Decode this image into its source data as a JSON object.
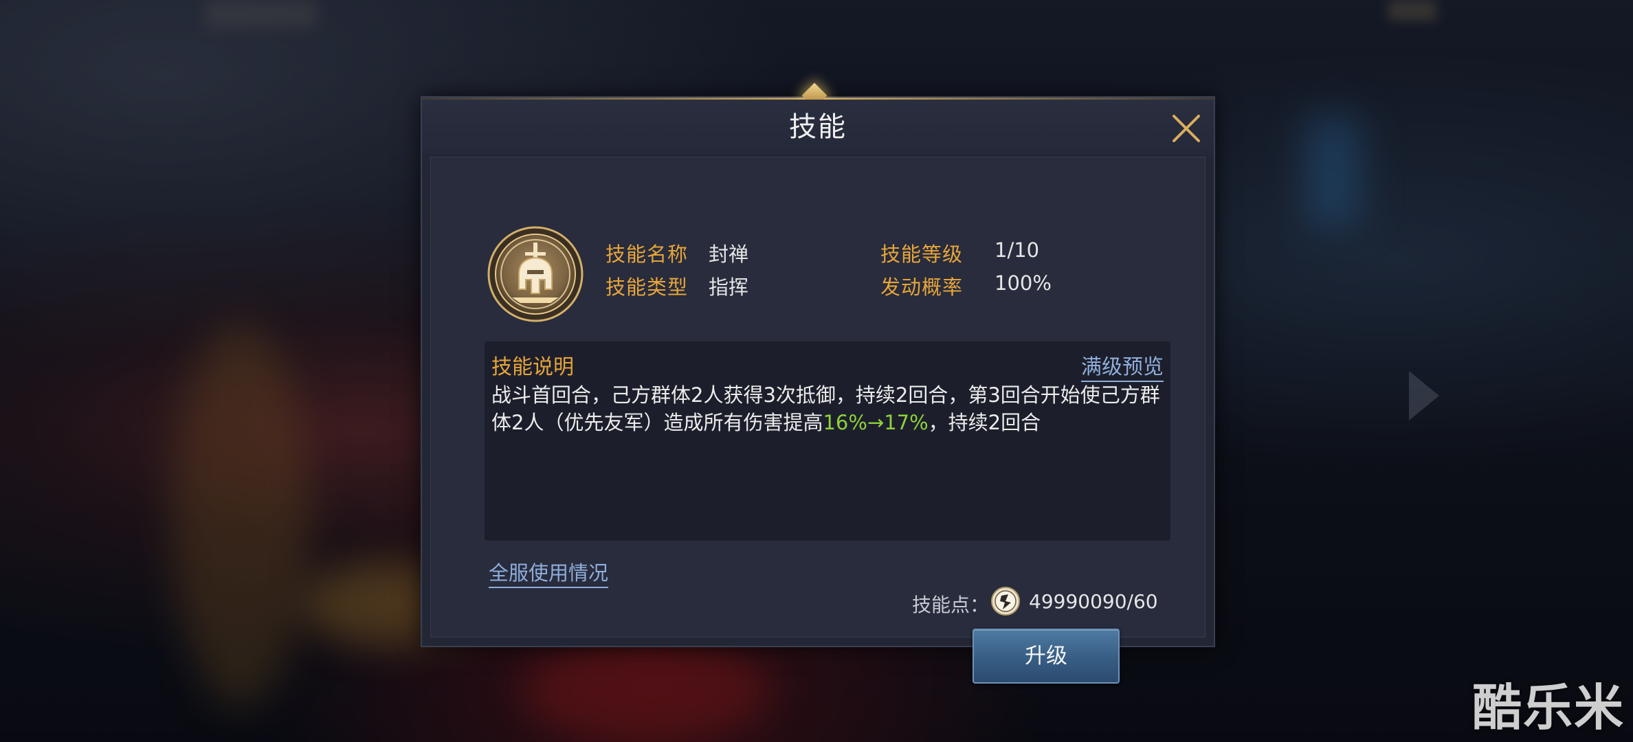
{
  "dialog": {
    "title": "技能",
    "close_icon": "close-icon"
  },
  "skill": {
    "icon": "helmet-sword-emblem-icon",
    "name_label": "技能名称",
    "name_value": "封禅",
    "level_label": "技能等级",
    "level_value": "1/10",
    "type_label": "技能类型",
    "type_value": "指挥",
    "chance_label": "发动概率",
    "chance_value": "100%"
  },
  "description": {
    "title": "技能说明",
    "preview_link": "满级预览",
    "text_part1": "战斗首回合，己方群体2人获得3次抵御，持续2回合，第3回合开始使己方群体2人（优先友军）造成所有伤害提高",
    "highlight": "16%→17%",
    "text_part2": "，持续2回合",
    "highlight_color": "#8fd13b"
  },
  "usage_link": "全服使用情况",
  "points": {
    "label": "技能点：",
    "icon": "skill-point-token-icon",
    "value": "49990090/60"
  },
  "upgrade_button": "升级",
  "watermark": "酷乐米",
  "colors": {
    "label_gold": "#e8a53a",
    "link_blue": "#8faedc",
    "dialog_bg": "#222635",
    "button_blue": "#375d84"
  }
}
